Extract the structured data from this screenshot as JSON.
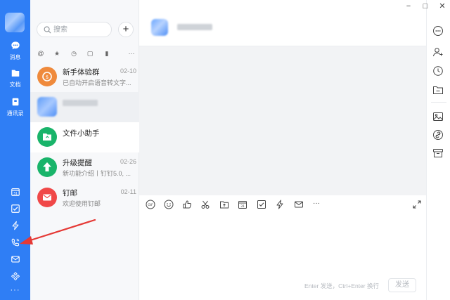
{
  "rail": {
    "items": [
      {
        "label": "消息",
        "icon": "chat-bubble-icon"
      },
      {
        "label": "文档",
        "icon": "document-folder-icon"
      },
      {
        "label": "通讯录",
        "icon": "contacts-book-icon"
      }
    ],
    "bottom_icons": [
      "calendar-icon",
      "todo-check-icon",
      "lightning-icon",
      "phone-call-icon",
      "mail-icon",
      "apps-icon",
      "more-dots-icon"
    ],
    "calendar_day": "31"
  },
  "search": {
    "placeholder": "搜索"
  },
  "list_plus": "+",
  "conversations": [
    {
      "name": "新手体验群",
      "date": "02-10",
      "preview": "已自动开启语音转文字...",
      "color": "#ef8a3c"
    },
    {
      "name": "",
      "date": "",
      "preview": "",
      "color": "#5e9cf7"
    },
    {
      "name": "文件小助手",
      "date": "",
      "preview": "",
      "color": "#19b46a"
    },
    {
      "name": "升级提醒",
      "date": "02-26",
      "preview": "新功能介绍丨钉钉5.0, ...",
      "color": "#19b46a"
    },
    {
      "name": "钉邮",
      "date": "02-11",
      "preview": "欢迎使用钉邮",
      "color": "#f04848"
    }
  ],
  "composer": {
    "hint": "Enter 发送，Ctrl+Enter 换行",
    "send_label": "发送",
    "gif_label": "GIF",
    "toolbar_more": "···"
  },
  "window": {
    "min": "−",
    "max": "□",
    "close": "✕"
  },
  "colors": {
    "accent": "#2f7ef5",
    "annotation": "#e53935"
  }
}
